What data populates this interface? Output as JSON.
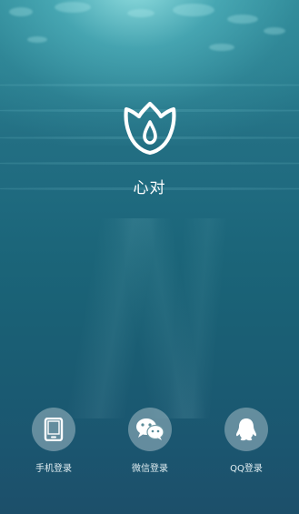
{
  "app": {
    "name": "心对",
    "logo_icon": "tulip-drop-logo"
  },
  "login_options": [
    {
      "label": "手机登录",
      "icon": "phone-icon"
    },
    {
      "label": "微信登录",
      "icon": "wechat-icon"
    },
    {
      "label": "QQ登录",
      "icon": "qq-penguin-icon"
    }
  ],
  "colors": {
    "water_top": "#2f8a98",
    "water_bottom": "#1c4f6a",
    "text": "#ffffff"
  }
}
